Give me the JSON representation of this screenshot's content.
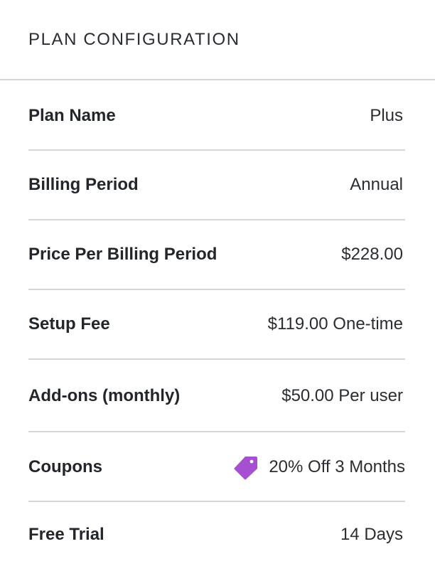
{
  "panel": {
    "title": "PLAN CONFIGURATION"
  },
  "rows": [
    {
      "label": "Plan Name",
      "value": "Plus"
    },
    {
      "label": "Billing Period",
      "value": "Annual"
    },
    {
      "label": "Price Per Billing Period",
      "value": "$228.00"
    },
    {
      "label": "Setup Fee",
      "value": "$119.00 One-time"
    },
    {
      "label": "Add-ons (monthly)",
      "value": "$50.00 Per user"
    },
    {
      "label": "Coupons",
      "value": "20% Off 3 Months",
      "icon": "tag-icon"
    },
    {
      "label": "Free Trial",
      "value": "14 Days"
    }
  ],
  "colors": {
    "coupon_tag": "#a64fd0",
    "divider": "#d4d6da"
  }
}
